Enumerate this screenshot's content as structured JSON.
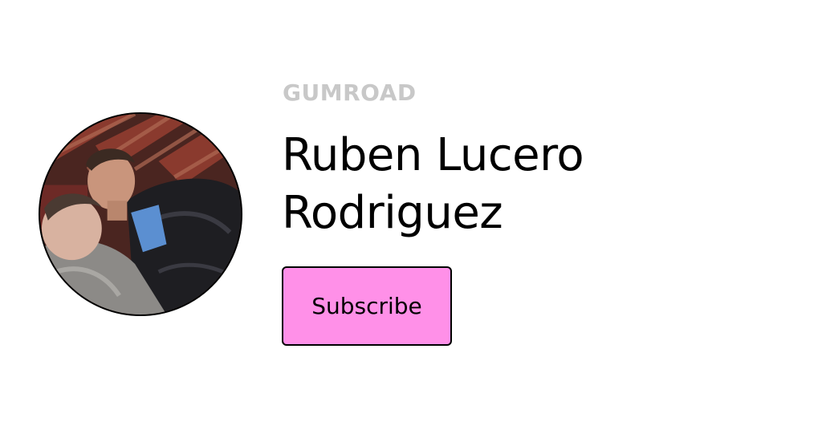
{
  "brand": {
    "name": "GUMROAD"
  },
  "profile": {
    "name": "Ruben Lucero Rodriguez",
    "avatar_alt": ""
  },
  "actions": {
    "subscribe_label": "Subscribe"
  },
  "colors": {
    "background": "#ffffff",
    "brand_text": "#c8c8c8",
    "button_fill": "#ff90e8",
    "border": "#000000",
    "text": "#000000"
  }
}
